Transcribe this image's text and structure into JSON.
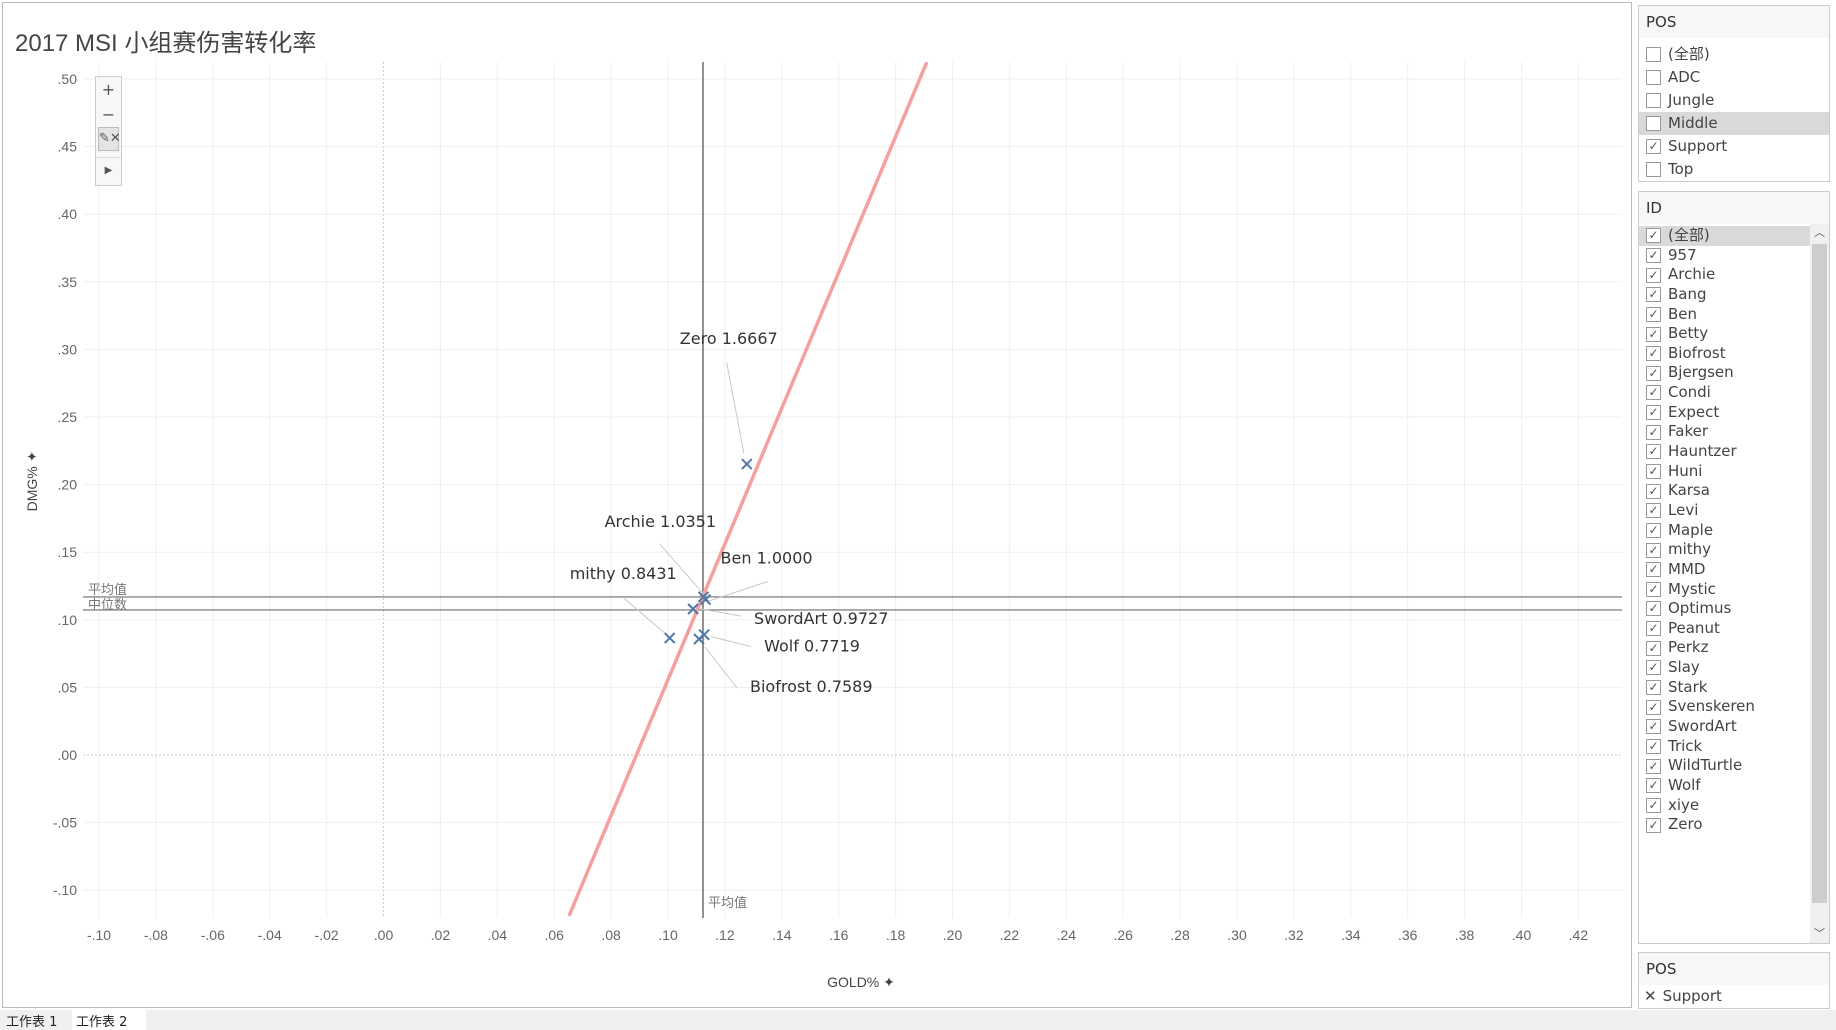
{
  "chart_data": {
    "type": "scatter",
    "title": "2017 MSI 小组赛伤害转化率",
    "xlabel": "GOLD%",
    "ylabel": "DMG%",
    "xlim": [
      -0.11,
      0.43
    ],
    "ylim": [
      -0.12,
      0.515
    ],
    "xticks": [
      -0.1,
      -0.08,
      -0.06,
      -0.04,
      -0.02,
      0.0,
      0.02,
      0.04,
      0.06,
      0.08,
      0.1,
      0.12,
      0.14,
      0.16,
      0.18,
      0.2,
      0.22,
      0.24,
      0.26,
      0.28,
      0.3,
      0.32,
      0.34,
      0.36,
      0.38,
      0.4,
      0.42
    ],
    "yticks": [
      0.5,
      0.45,
      0.4,
      0.35,
      0.3,
      0.25,
      0.2,
      0.15,
      0.1,
      0.05,
      0.0,
      -0.05,
      -0.1
    ],
    "grid": true,
    "marker": "x",
    "marker_color": "#4e79a7",
    "points": [
      {
        "id": "Zero",
        "ratio": "1.6667",
        "x": 0.1277,
        "y": 0.2152
      },
      {
        "id": "Archie",
        "ratio": "1.0351",
        "x": 0.1125,
        "y": 0.117
      },
      {
        "id": "Ben",
        "ratio": "1.0000",
        "x": 0.1132,
        "y": 0.115
      },
      {
        "id": "mithy",
        "ratio": "0.8431",
        "x": 0.1006,
        "y": 0.0865
      },
      {
        "id": "SwordArt",
        "ratio": "0.9727",
        "x": 0.1088,
        "y": 0.108
      },
      {
        "id": "Wolf",
        "ratio": "0.7719",
        "x": 0.1127,
        "y": 0.089
      },
      {
        "id": "Biofrost",
        "ratio": "0.7589",
        "x": 0.1109,
        "y": 0.0858
      }
    ],
    "trend_line": {
      "color": "#f4a0a0",
      "from": [
        0.0652,
        -0.119
      ],
      "to": [
        0.191,
        0.5126
      ]
    },
    "reference_lines": [
      {
        "axis": "x",
        "value": 0.1123,
        "label": "平均值"
      },
      {
        "axis": "y",
        "value": 0.1169,
        "label": "平均值"
      },
      {
        "axis": "y",
        "value": 0.1073,
        "label": "中位数"
      }
    ]
  },
  "filters": {
    "pos": {
      "title": "POS",
      "items": [
        {
          "label": "(全部)",
          "checked": false
        },
        {
          "label": "ADC",
          "checked": false
        },
        {
          "label": "Jungle",
          "checked": false
        },
        {
          "label": "Middle",
          "checked": false,
          "highlighted": true
        },
        {
          "label": "Support",
          "checked": true
        },
        {
          "label": "Top",
          "checked": false
        }
      ]
    },
    "id": {
      "title": "ID",
      "items": [
        "(全部)",
        "957",
        "Archie",
        "Bang",
        "Ben",
        "Betty",
        "Biofrost",
        "Bjergsen",
        "Condi",
        "Expect",
        "Faker",
        "Hauntzer",
        "Huni",
        "Karsa",
        "Levi",
        "Maple",
        "mithy",
        "MMD",
        "Mystic",
        "Optimus",
        "Peanut",
        "Perkz",
        "Slay",
        "Stark",
        "Svenskeren",
        "SwordArt",
        "Trick",
        "WildTurtle",
        "Wolf",
        "xiye",
        "Zero"
      ]
    },
    "legend": {
      "title": "POS",
      "item": "Support",
      "icon": "x-mark"
    }
  },
  "zoom_controls": {
    "zoom_in": "+",
    "zoom_out": "−",
    "pin": "pin-x-icon",
    "play": "▶"
  },
  "tabs": [
    "工作表 1",
    "工作表 2"
  ]
}
